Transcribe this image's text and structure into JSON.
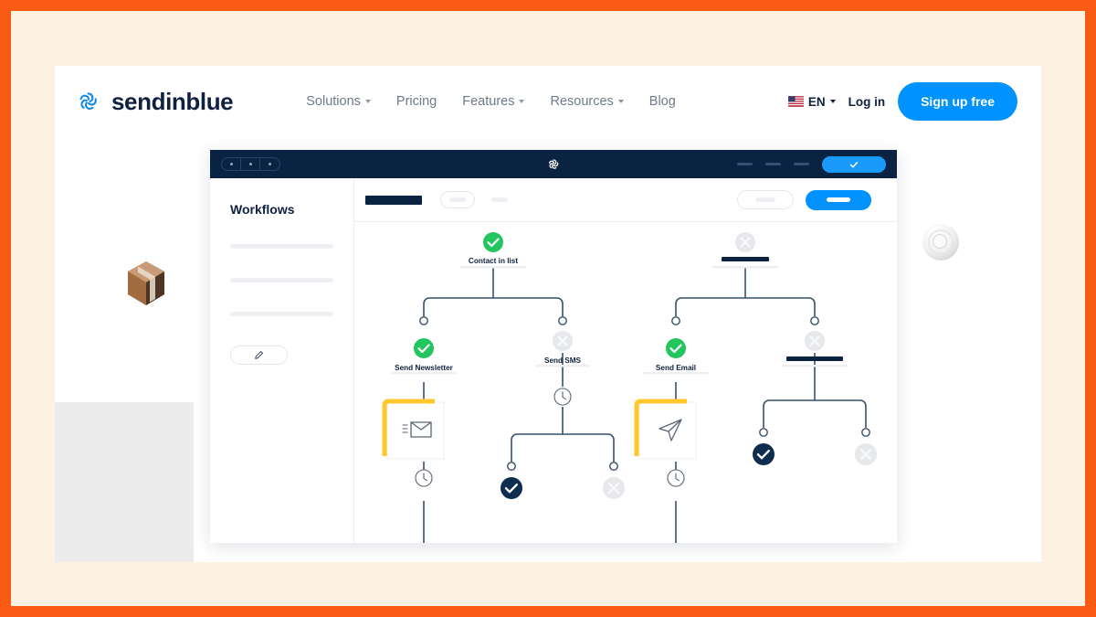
{
  "colors": {
    "frame_orange": "#F95A14",
    "page_cream": "#FDF2E2",
    "brand_navy": "#10213F",
    "accent_blue": "#0092FF",
    "success_green": "#22C55E",
    "muted_grey": "#DFE3E8",
    "card_yellow": "#FFC72C",
    "panel_grey": "#ECECEC",
    "titlebar_navy": "#0A2342"
  },
  "header": {
    "brand_name": "sendinblue",
    "brand_logo_icon": "sendinblue-pinwheel-icon",
    "nav": [
      {
        "label": "Solutions",
        "has_caret": true
      },
      {
        "label": "Pricing",
        "has_caret": false
      },
      {
        "label": "Features",
        "has_caret": true
      },
      {
        "label": "Resources",
        "has_caret": true
      },
      {
        "label": "Blog",
        "has_caret": false
      }
    ],
    "language": {
      "code": "EN",
      "flag_icon": "us-flag-icon",
      "has_caret": true
    },
    "login_label": "Log in",
    "signup_label": "Sign up free"
  },
  "app_window": {
    "titlebar": {
      "logo_icon": "sendinblue-pinwheel-icon",
      "nav_dots": 3,
      "window_dashes": 3,
      "action_pill_icon": "check-icon"
    },
    "sidebar": {
      "title": "Workflows",
      "placeholder_lines": 3,
      "edit_button_icon": "pencil-icon"
    },
    "toolbar": {
      "title_bar_placeholder": true,
      "pill_placeholder": true,
      "ghost_placeholder": true,
      "outline_button_placeholder": true,
      "primary_button_placeholder": true
    },
    "workflow": {
      "title": "Workflows",
      "nodes": [
        {
          "id": "contact-in-list",
          "label": "Contact in list",
          "status": "success",
          "label_style": "text"
        },
        {
          "id": "right-trigger",
          "label": "",
          "status": "disabled",
          "label_style": "bar"
        },
        {
          "id": "send-newsletter",
          "label": "Send Newsletter",
          "status": "success",
          "label_style": "text"
        },
        {
          "id": "send-sms",
          "label": "Send SMS",
          "status": "disabled",
          "label_style": "text"
        },
        {
          "id": "send-email",
          "label": "Send Email",
          "status": "success",
          "label_style": "text"
        },
        {
          "id": "right-action",
          "label": "",
          "status": "disabled",
          "label_style": "bar"
        }
      ],
      "cards": [
        {
          "id": "newsletter-card",
          "icon": "envelope-icon",
          "accent": "#FFC72C"
        },
        {
          "id": "email-card",
          "icon": "paper-plane-icon",
          "accent": "#FFC72C"
        }
      ],
      "timers": [
        {
          "id": "timer-newsletter",
          "icon": "clock-icon"
        },
        {
          "id": "timer-sms",
          "icon": "clock-icon"
        },
        {
          "id": "timer-email",
          "icon": "clock-icon"
        }
      ],
      "outcomes": [
        {
          "id": "sms-yes",
          "icon": "check-icon",
          "status": "confirmed"
        },
        {
          "id": "sms-no",
          "icon": "close-icon",
          "status": "disabled"
        },
        {
          "id": "right-yes",
          "icon": "check-icon",
          "status": "confirmed"
        },
        {
          "id": "right-no",
          "icon": "close-icon",
          "status": "disabled"
        }
      ]
    }
  },
  "decorations": [
    {
      "id": "cardboard-box",
      "name": "3d-box-object"
    },
    {
      "id": "metal-ring",
      "name": "3d-ring-object"
    }
  ]
}
